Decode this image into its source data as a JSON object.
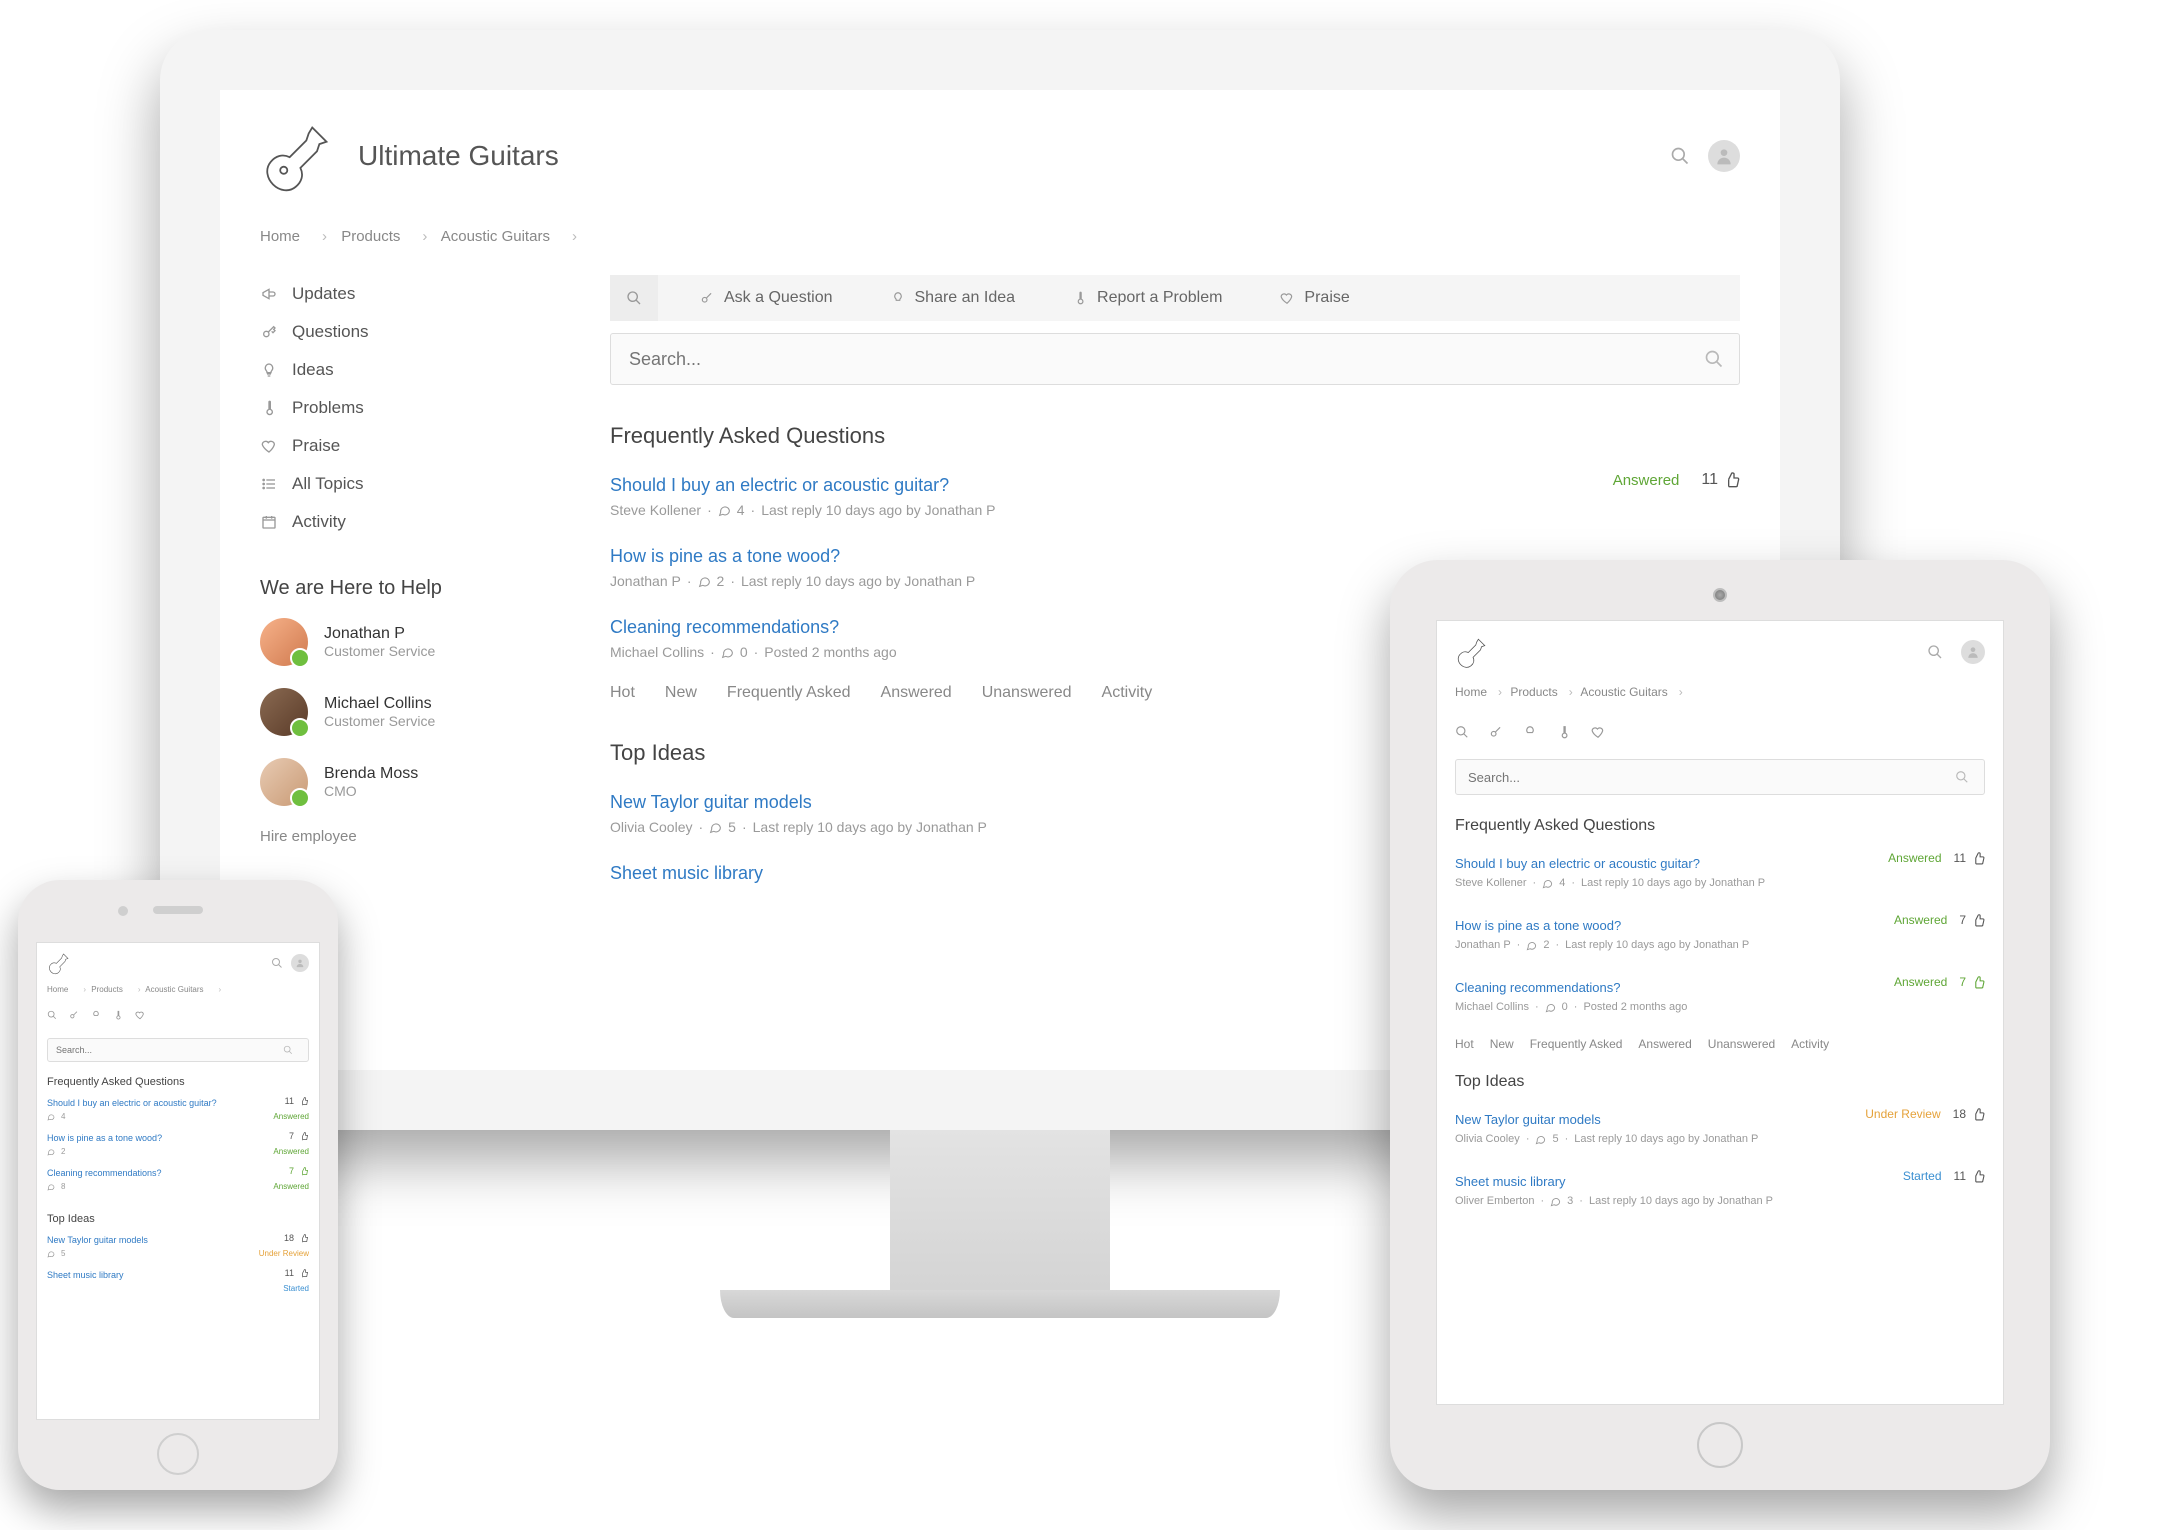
{
  "brand": {
    "title": "Ultimate Guitars"
  },
  "breadcrumbs": [
    "Home",
    "Products",
    "Acoustic Guitars"
  ],
  "sidebar": {
    "items": [
      {
        "icon": "megaphone-icon",
        "label": "Updates"
      },
      {
        "icon": "key-icon",
        "label": "Questions"
      },
      {
        "icon": "bulb-icon",
        "label": "Ideas"
      },
      {
        "icon": "thermometer-icon",
        "label": "Problems"
      },
      {
        "icon": "heart-icon",
        "label": "Praise"
      },
      {
        "icon": "list-icon",
        "label": "All Topics"
      },
      {
        "icon": "calendar-icon",
        "label": "Activity"
      }
    ],
    "help_heading": "We are Here to Help",
    "helpers": [
      {
        "name": "Jonathan P",
        "role": "Customer Service"
      },
      {
        "name": "Michael Collins",
        "role": "Customer Service"
      },
      {
        "name": "Brenda Moss",
        "role": "CMO"
      }
    ],
    "hire_link": "Hire employee"
  },
  "tabs": [
    {
      "icon": "search-icon",
      "label": ""
    },
    {
      "icon": "key-icon",
      "label": "Ask a Question"
    },
    {
      "icon": "bulb-icon",
      "label": "Share an Idea"
    },
    {
      "icon": "thermometer-icon",
      "label": "Report a Problem"
    },
    {
      "icon": "heart-icon",
      "label": "Praise"
    }
  ],
  "search": {
    "placeholder": "Search..."
  },
  "sections": {
    "faq_title": "Frequently Asked Questions",
    "ideas_title": "Top Ideas"
  },
  "faq": [
    {
      "title": "Should I buy an electric or acoustic guitar?",
      "author": "Steve Kollener",
      "comments": 4,
      "meta": "Last reply 10 days ago by Jonathan P",
      "status": "Answered",
      "votes": 11
    },
    {
      "title": "How is pine as a tone wood?",
      "author": "Jonathan P",
      "comments": 2,
      "meta": "Last reply 10 days ago by Jonathan P",
      "status": "Answered",
      "votes": 7
    },
    {
      "title": "Cleaning recommendations?",
      "author": "Michael Collins",
      "comments": 0,
      "meta": "Posted 2 months ago",
      "status": "Answered",
      "votes": 7,
      "votes_green": true
    }
  ],
  "filters": [
    "Hot",
    "New",
    "Frequently Asked",
    "Answered",
    "Unanswered",
    "Activity"
  ],
  "ideas": [
    {
      "title": "New Taylor guitar models",
      "author": "Olivia Cooley",
      "comments": 5,
      "meta": "Last reply 10 days ago by Jonathan P",
      "status": "Under Review",
      "status_class": "status-review",
      "votes": 18
    },
    {
      "title": "Sheet music library",
      "author": "Oliver Emberton",
      "comments": 3,
      "meta": "Last reply 10 days ago by Jonathan P",
      "status": "Started",
      "status_class": "status-started",
      "votes": 11
    }
  ],
  "phone_faq_last_comments": 8
}
